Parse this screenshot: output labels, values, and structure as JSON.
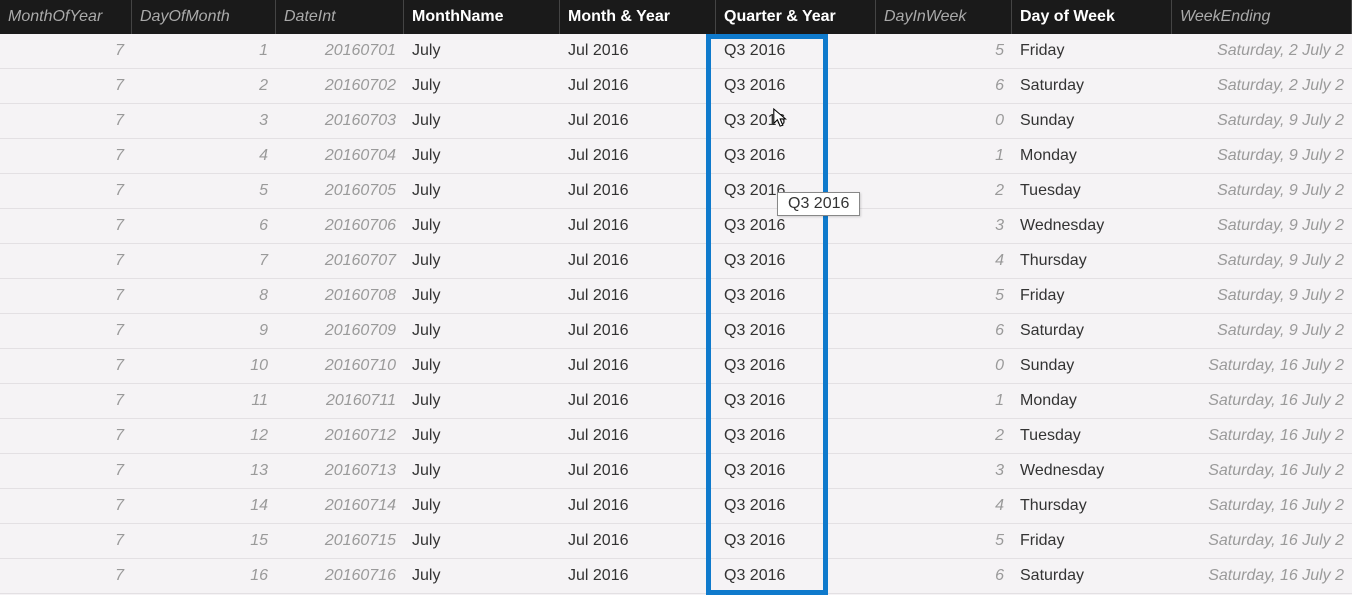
{
  "columns": [
    {
      "label": "MonthOfYear",
      "dim": true,
      "align": "right"
    },
    {
      "label": "DayOfMonth",
      "dim": true,
      "align": "right"
    },
    {
      "label": "DateInt",
      "dim": true,
      "align": "right"
    },
    {
      "label": "MonthName",
      "dim": false,
      "align": "left"
    },
    {
      "label": "Month & Year",
      "dim": false,
      "align": "left"
    },
    {
      "label": "Quarter & Year",
      "dim": false,
      "align": "left"
    },
    {
      "label": "DayInWeek",
      "dim": true,
      "align": "right"
    },
    {
      "label": "Day of Week",
      "dim": false,
      "align": "left"
    },
    {
      "label": "WeekEnding",
      "dim": true,
      "align": "right"
    }
  ],
  "rows": [
    {
      "monthOfYear": "7",
      "dayOfMonth": "1",
      "dateInt": "20160701",
      "monthName": "July",
      "monthYear": "Jul 2016",
      "quarterYear": "Q3 2016",
      "dayInWeek": "5",
      "dayOfWeek": "Friday",
      "weekEnding": "Saturday, 2 July 2"
    },
    {
      "monthOfYear": "7",
      "dayOfMonth": "2",
      "dateInt": "20160702",
      "monthName": "July",
      "monthYear": "Jul 2016",
      "quarterYear": "Q3 2016",
      "dayInWeek": "6",
      "dayOfWeek": "Saturday",
      "weekEnding": "Saturday, 2 July 2"
    },
    {
      "monthOfYear": "7",
      "dayOfMonth": "3",
      "dateInt": "20160703",
      "monthName": "July",
      "monthYear": "Jul 2016",
      "quarterYear": "Q3 2016",
      "dayInWeek": "0",
      "dayOfWeek": "Sunday",
      "weekEnding": "Saturday, 9 July 2"
    },
    {
      "monthOfYear": "7",
      "dayOfMonth": "4",
      "dateInt": "20160704",
      "monthName": "July",
      "monthYear": "Jul 2016",
      "quarterYear": "Q3 2016",
      "dayInWeek": "1",
      "dayOfWeek": "Monday",
      "weekEnding": "Saturday, 9 July 2"
    },
    {
      "monthOfYear": "7",
      "dayOfMonth": "5",
      "dateInt": "20160705",
      "monthName": "July",
      "monthYear": "Jul 2016",
      "quarterYear": "Q3 2016",
      "dayInWeek": "2",
      "dayOfWeek": "Tuesday",
      "weekEnding": "Saturday, 9 July 2"
    },
    {
      "monthOfYear": "7",
      "dayOfMonth": "6",
      "dateInt": "20160706",
      "monthName": "July",
      "monthYear": "Jul 2016",
      "quarterYear": "Q3 2016",
      "dayInWeek": "3",
      "dayOfWeek": "Wednesday",
      "weekEnding": "Saturday, 9 July 2"
    },
    {
      "monthOfYear": "7",
      "dayOfMonth": "7",
      "dateInt": "20160707",
      "monthName": "July",
      "monthYear": "Jul 2016",
      "quarterYear": "Q3 2016",
      "dayInWeek": "4",
      "dayOfWeek": "Thursday",
      "weekEnding": "Saturday, 9 July 2"
    },
    {
      "monthOfYear": "7",
      "dayOfMonth": "8",
      "dateInt": "20160708",
      "monthName": "July",
      "monthYear": "Jul 2016",
      "quarterYear": "Q3 2016",
      "dayInWeek": "5",
      "dayOfWeek": "Friday",
      "weekEnding": "Saturday, 9 July 2"
    },
    {
      "monthOfYear": "7",
      "dayOfMonth": "9",
      "dateInt": "20160709",
      "monthName": "July",
      "monthYear": "Jul 2016",
      "quarterYear": "Q3 2016",
      "dayInWeek": "6",
      "dayOfWeek": "Saturday",
      "weekEnding": "Saturday, 9 July 2"
    },
    {
      "monthOfYear": "7",
      "dayOfMonth": "10",
      "dateInt": "20160710",
      "monthName": "July",
      "monthYear": "Jul 2016",
      "quarterYear": "Q3 2016",
      "dayInWeek": "0",
      "dayOfWeek": "Sunday",
      "weekEnding": "Saturday, 16 July 2"
    },
    {
      "monthOfYear": "7",
      "dayOfMonth": "11",
      "dateInt": "20160711",
      "monthName": "July",
      "monthYear": "Jul 2016",
      "quarterYear": "Q3 2016",
      "dayInWeek": "1",
      "dayOfWeek": "Monday",
      "weekEnding": "Saturday, 16 July 2"
    },
    {
      "monthOfYear": "7",
      "dayOfMonth": "12",
      "dateInt": "20160712",
      "monthName": "July",
      "monthYear": "Jul 2016",
      "quarterYear": "Q3 2016",
      "dayInWeek": "2",
      "dayOfWeek": "Tuesday",
      "weekEnding": "Saturday, 16 July 2"
    },
    {
      "monthOfYear": "7",
      "dayOfMonth": "13",
      "dateInt": "20160713",
      "monthName": "July",
      "monthYear": "Jul 2016",
      "quarterYear": "Q3 2016",
      "dayInWeek": "3",
      "dayOfWeek": "Wednesday",
      "weekEnding": "Saturday, 16 July 2"
    },
    {
      "monthOfYear": "7",
      "dayOfMonth": "14",
      "dateInt": "20160714",
      "monthName": "July",
      "monthYear": "Jul 2016",
      "quarterYear": "Q3 2016",
      "dayInWeek": "4",
      "dayOfWeek": "Thursday",
      "weekEnding": "Saturday, 16 July 2"
    },
    {
      "monthOfYear": "7",
      "dayOfMonth": "15",
      "dateInt": "20160715",
      "monthName": "July",
      "monthYear": "Jul 2016",
      "quarterYear": "Q3 2016",
      "dayInWeek": "5",
      "dayOfWeek": "Friday",
      "weekEnding": "Saturday, 16 July 2"
    },
    {
      "monthOfYear": "7",
      "dayOfMonth": "16",
      "dateInt": "20160716",
      "monthName": "July",
      "monthYear": "Jul 2016",
      "quarterYear": "Q3 2016",
      "dayInWeek": "6",
      "dayOfWeek": "Saturday",
      "weekEnding": "Saturday, 16 July 2"
    }
  ],
  "tooltip": "Q3 2016"
}
